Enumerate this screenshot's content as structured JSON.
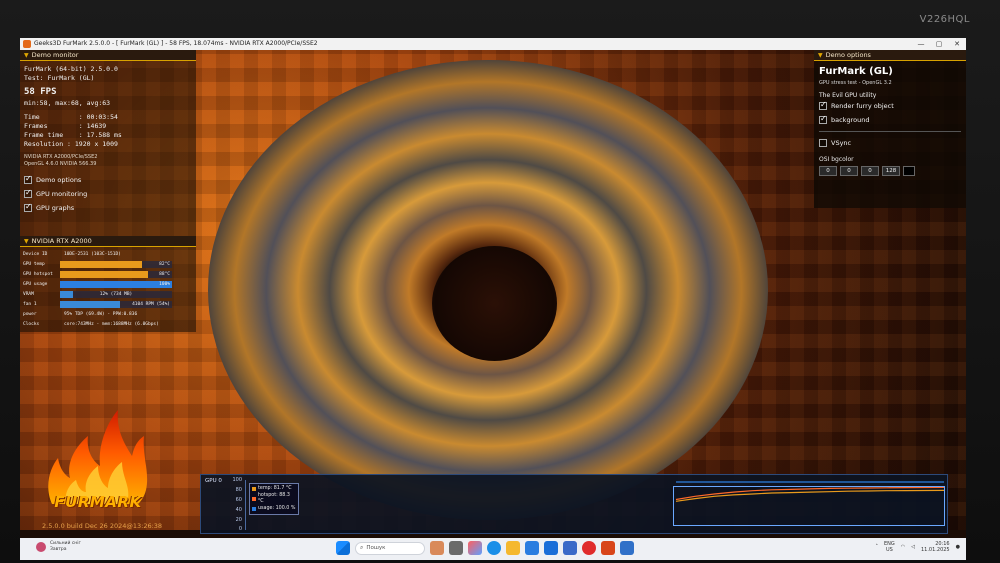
{
  "monitor": {
    "brand": "V226HQL"
  },
  "window": {
    "title": "Geeks3D FurMark 2.5.0.0 - [ FurMark (GL) ] - 58 FPS, 18.074ms - NVIDIA RTX A2000/PCIe/SSE2",
    "minimize": "—",
    "maximize": "▢",
    "close": "✕"
  },
  "demo_monitor": {
    "header": "Demo monitor",
    "app": "FurMark (64-bit) 2.5.0.0",
    "test": "Test: FurMark (GL)",
    "fps": "58 FPS",
    "fps_stats": "min:58, max:68, avg:63",
    "time": "Time          : 00:03:54",
    "frames": "Frames        : 14639",
    "frame_time": "Frame time    : 17.588 ms",
    "resolution": "Resolution : 1920 x 1009",
    "gpu_line": "NVIDIA RTX A2000/PCIe/SSE2",
    "gl_line": "OpenGL 4.6.0 NVIDIA 566.39",
    "options": [
      {
        "label": "Demo options",
        "checked": true
      },
      {
        "label": "GPU monitoring",
        "checked": true
      },
      {
        "label": "GPU graphs",
        "checked": true
      }
    ]
  },
  "gpu_monitor": {
    "header": "NVIDIA RTX A2000",
    "device_id_label": "Device ID",
    "device_id_value": "10DE-2531 (103C-151D)",
    "rows": [
      {
        "label": "GPU temp",
        "text": "82°C",
        "level": 0.73,
        "color": "#e89a1c"
      },
      {
        "label": "GPU hotspot",
        "text": "88°C",
        "level": 0.79,
        "color": "#e89a1c"
      },
      {
        "label": "GPU usage",
        "text": "100%",
        "level": 1.0,
        "color": "#2c7fe0"
      },
      {
        "label": "VRAM",
        "text": "12% (734 MB)",
        "level": 0.12,
        "color": "#3a8ad8"
      },
      {
        "label": "fan 1",
        "text": "4104 RPM (54%)",
        "level": 0.54,
        "color": "#3a8ad8"
      }
    ],
    "power_label": "power",
    "power_value": "95% TDP (69.4W) - PPW:0.836",
    "clocks_label": "Clocks",
    "clocks_value": "core:743MHz - mem:1688MHz (6.0Gbps)"
  },
  "branding": {
    "logo_text": "FURMARK",
    "build": "2.5.0.0 build Dec 26 2024@13:26:38"
  },
  "demo_options": {
    "header": "Demo options",
    "title": "FurMark (GL)",
    "subtitle": "GPU stress test - OpenGL 3.2",
    "util_label": "The Evil GPU utility",
    "checkboxes": [
      {
        "label": "Render furry object",
        "checked": true
      },
      {
        "label": "background",
        "checked": true
      }
    ],
    "vsync": {
      "label": "VSync",
      "checked": false
    },
    "osi_label": "OSI bgcolor",
    "osi_values": [
      "0",
      "0",
      "0",
      "128"
    ]
  },
  "gpu_graph": {
    "title": "GPU 0",
    "yticks": [
      "100",
      "80",
      "60",
      "40",
      "20",
      "0"
    ],
    "legend": [
      {
        "label": "temp: 81.7 °C",
        "color": "#e89a1c"
      },
      {
        "label": "hotspot: 88.3 °C",
        "color": "#ff6a2a"
      },
      {
        "label": "usage: 100.0 %",
        "color": "#2c7fe0"
      }
    ],
    "chart_data": {
      "type": "line",
      "ylim": [
        0,
        100
      ],
      "series": [
        {
          "name": "temp",
          "values": [
            58,
            64,
            69,
            72,
            74,
            76,
            77,
            78,
            79,
            80,
            80.5,
            81,
            81.3,
            81.5,
            81.7
          ]
        },
        {
          "name": "hotspot",
          "values": [
            62,
            69,
            74,
            78,
            81,
            83,
            84,
            85,
            86,
            86.5,
            87,
            87.5,
            87.9,
            88.1,
            88.3
          ]
        },
        {
          "name": "usage",
          "values": [
            100,
            100,
            100,
            100,
            100,
            100,
            100,
            100,
            100,
            100,
            100,
            100,
            100,
            100,
            100
          ]
        }
      ]
    }
  },
  "taskbar": {
    "weather_line1": "Сильний сніг",
    "weather_line2": "Завтра",
    "search_placeholder": "Пошук",
    "lang_line1": "ENG",
    "lang_line2": "US",
    "time": "20:16",
    "date": "11.01.2025"
  }
}
